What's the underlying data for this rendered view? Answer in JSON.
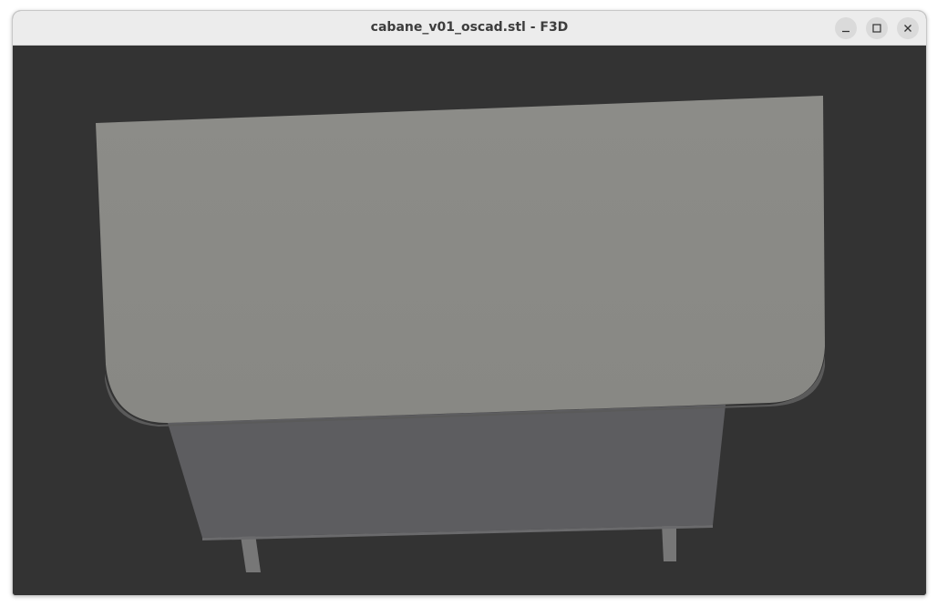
{
  "window": {
    "title": "cabane_v01_oscad.stl - F3D"
  },
  "titlebar_buttons": [
    {
      "name": "minimize",
      "icon": "minimize-icon"
    },
    {
      "name": "maximize",
      "icon": "maximize-icon"
    },
    {
      "name": "close",
      "icon": "close-icon"
    }
  ],
  "viewport": {
    "background_color": "#333333",
    "model_top_color": "#8a8a85",
    "model_side_color": "#5d5d60",
    "model_leg_color": "#777777"
  }
}
